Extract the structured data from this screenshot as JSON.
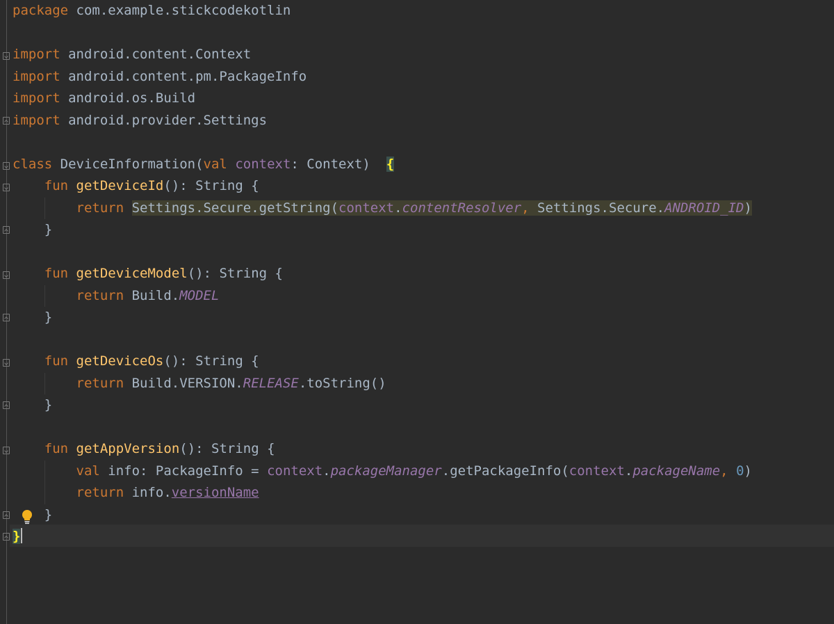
{
  "editor": {
    "language": "kotlin",
    "colors": {
      "background": "#2b2b2b",
      "keyword": "#cc7832",
      "function": "#ffc66d",
      "property": "#9876aa",
      "number": "#6897bb",
      "text": "#a9b7c6",
      "usage_highlight": "#414030",
      "brace_match": "#3b514d"
    },
    "lines": [
      {
        "tokens": [
          [
            "kw",
            "package"
          ],
          [
            "plain",
            " com.example.stickcodekotlin"
          ]
        ]
      },
      {
        "tokens": []
      },
      {
        "tokens": [
          [
            "kw",
            "import"
          ],
          [
            "plain",
            " android.content.Context"
          ]
        ]
      },
      {
        "tokens": [
          [
            "kw",
            "import"
          ],
          [
            "plain",
            " android.content.pm.PackageInfo"
          ]
        ]
      },
      {
        "tokens": [
          [
            "kw",
            "import"
          ],
          [
            "plain",
            " android.os.Build"
          ]
        ]
      },
      {
        "tokens": [
          [
            "kw",
            "import"
          ],
          [
            "plain",
            " android.provider.Settings"
          ]
        ]
      },
      {
        "tokens": []
      },
      {
        "tokens": [
          [
            "kw",
            "class"
          ],
          [
            "plain",
            " DeviceInformation("
          ],
          [
            "kw",
            "val"
          ],
          [
            "plain",
            " "
          ],
          [
            "prop",
            "context"
          ],
          [
            "plain",
            ": Context)  "
          ],
          [
            "brace-hl",
            "{"
          ]
        ]
      },
      {
        "tokens": [
          [
            "plain",
            "    "
          ],
          [
            "kw",
            "fun"
          ],
          [
            "plain",
            " "
          ],
          [
            "fn",
            "getDeviceId"
          ],
          [
            "plain",
            "(): String {"
          ]
        ]
      },
      {
        "tokens": [
          [
            "plain",
            "        "
          ],
          [
            "kw",
            "return"
          ],
          [
            "plain",
            " "
          ],
          [
            "hl-plain",
            "Settings.Secure.getString("
          ],
          [
            "hl-prop",
            "context"
          ],
          [
            "hl-plain",
            "."
          ],
          [
            "hl-propi",
            "contentResolver"
          ],
          [
            "hl-kw",
            ","
          ],
          [
            "hl-plain",
            " Settings.Secure."
          ],
          [
            "hl-propi",
            "ANDROID_ID"
          ],
          [
            "hl-plain",
            ")"
          ]
        ]
      },
      {
        "tokens": [
          [
            "plain",
            "    }"
          ]
        ]
      },
      {
        "tokens": []
      },
      {
        "tokens": [
          [
            "plain",
            "    "
          ],
          [
            "kw",
            "fun"
          ],
          [
            "plain",
            " "
          ],
          [
            "fn",
            "getDeviceModel"
          ],
          [
            "plain",
            "(): String {"
          ]
        ]
      },
      {
        "tokens": [
          [
            "plain",
            "        "
          ],
          [
            "kw",
            "return"
          ],
          [
            "plain",
            " Build."
          ],
          [
            "propi",
            "MODEL"
          ]
        ]
      },
      {
        "tokens": [
          [
            "plain",
            "    }"
          ]
        ]
      },
      {
        "tokens": []
      },
      {
        "tokens": [
          [
            "plain",
            "    "
          ],
          [
            "kw",
            "fun"
          ],
          [
            "plain",
            " "
          ],
          [
            "fn",
            "getDeviceOs"
          ],
          [
            "plain",
            "(): String {"
          ]
        ]
      },
      {
        "tokens": [
          [
            "plain",
            "        "
          ],
          [
            "kw",
            "return"
          ],
          [
            "plain",
            " Build.VERSION."
          ],
          [
            "propi",
            "RELEASE"
          ],
          [
            "plain",
            ".toString()"
          ]
        ]
      },
      {
        "tokens": [
          [
            "plain",
            "    }"
          ]
        ]
      },
      {
        "tokens": []
      },
      {
        "tokens": [
          [
            "plain",
            "    "
          ],
          [
            "kw",
            "fun"
          ],
          [
            "plain",
            " "
          ],
          [
            "fn",
            "getAppVersion"
          ],
          [
            "plain",
            "(): String {"
          ]
        ]
      },
      {
        "tokens": [
          [
            "plain",
            "        "
          ],
          [
            "kw",
            "val"
          ],
          [
            "plain",
            " info: PackageInfo = "
          ],
          [
            "prop",
            "context"
          ],
          [
            "plain",
            "."
          ],
          [
            "propi",
            "packageManager"
          ],
          [
            "plain",
            ".getPackageInfo("
          ],
          [
            "prop",
            "context"
          ],
          [
            "plain",
            "."
          ],
          [
            "propi",
            "packageName"
          ],
          [
            "kw",
            ","
          ],
          [
            "plain",
            " "
          ],
          [
            "num",
            "0"
          ],
          [
            "plain",
            ")"
          ]
        ]
      },
      {
        "tokens": [
          [
            "plain",
            "        "
          ],
          [
            "kw",
            "return"
          ],
          [
            "plain",
            " info."
          ],
          [
            "prop-ul",
            "versionName"
          ]
        ]
      },
      {
        "tokens": [
          [
            "plain",
            "    }"
          ]
        ]
      },
      {
        "tokens": [
          [
            "brace-hl",
            "}"
          ]
        ]
      }
    ],
    "intention_icon": "lightbulb-icon"
  }
}
